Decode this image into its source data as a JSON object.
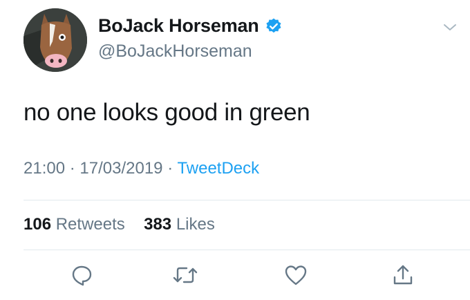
{
  "author": {
    "display_name": "BoJack Horseman",
    "handle": "@BoJackHorseman",
    "verified": true
  },
  "tweet": {
    "text": "no one looks good in green",
    "time": "21:00",
    "date": "17/03/2019",
    "separator": "·",
    "source": "TweetDeck"
  },
  "stats": {
    "retweets_count": "106",
    "retweets_label": "Retweets",
    "likes_count": "383",
    "likes_label": "Likes"
  },
  "actions": [
    "reply-icon",
    "retweet-icon",
    "like-icon",
    "share-icon"
  ],
  "colors": {
    "accent": "#1da1f2",
    "secondary_text": "#657786",
    "primary_text": "#14171a",
    "divider": "#e1e8ed"
  }
}
